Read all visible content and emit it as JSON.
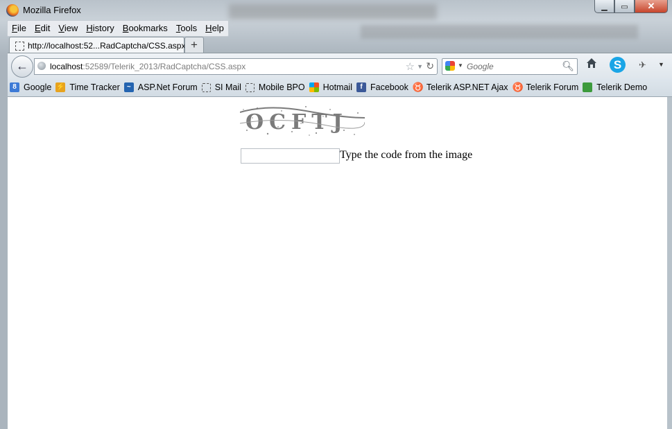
{
  "window": {
    "title": "Mozilla Firefox"
  },
  "menu": [
    "File",
    "Edit",
    "View",
    "History",
    "Bookmarks",
    "Tools",
    "Help"
  ],
  "tab": {
    "title": "http://localhost:52...RadCaptcha/CSS.aspx",
    "new_tab": "+"
  },
  "nav": {
    "url_host": "localhost",
    "url_rest": ":52589/Telerik_2013/RadCaptcha/CSS.aspx",
    "search_placeholder": "Google"
  },
  "bookmarks": [
    {
      "label": "Google",
      "icon": "google-icon",
      "color": "#3d7ad6"
    },
    {
      "label": "Time Tracker",
      "icon": "time-tracker-icon",
      "color": "#e7a31f"
    },
    {
      "label": "ASP.Net Forum",
      "icon": "aspnet-icon",
      "color": "#2464b0"
    },
    {
      "label": "SI Mail",
      "icon": "page-icon",
      "color": "#ffffff"
    },
    {
      "label": "Mobile BPO",
      "icon": "page-icon",
      "color": "#ffffff"
    },
    {
      "label": "Hotmail",
      "icon": "windows-icon",
      "color": "#e95d28"
    },
    {
      "label": "Facebook",
      "icon": "facebook-icon",
      "color": "#3b5998"
    },
    {
      "label": "Telerik ASP.NET Ajax",
      "icon": "telerik-icon",
      "color": "#5b8f22"
    },
    {
      "label": "Telerik Forum",
      "icon": "telerik-icon",
      "color": "#5b8f22"
    },
    {
      "label": "Telerik Demo",
      "icon": "image-icon",
      "color": "#3c9a3c"
    }
  ],
  "content": {
    "captcha_text": "OCFTJ",
    "input_value": "",
    "label": "Type the code from the image"
  }
}
